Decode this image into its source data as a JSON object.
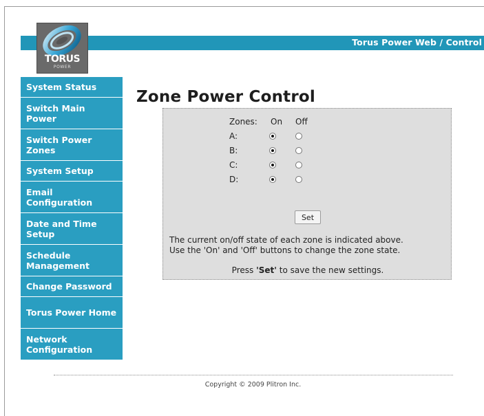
{
  "header": {
    "title": "Torus Power Web / Control",
    "logo_text": "TORUS",
    "logo_subtext": "POWER"
  },
  "sidebar": {
    "items": [
      {
        "label": "System Status"
      },
      {
        "label": "Switch Main Power"
      },
      {
        "label": "Switch Power Zones"
      },
      {
        "label": "System Setup"
      },
      {
        "label": "Email Configuration"
      },
      {
        "label": "Date and Time Setup"
      },
      {
        "label": "Schedule Management"
      },
      {
        "label": "Change Password"
      },
      {
        "label": "Torus Power Home"
      },
      {
        "label": "Network Configuration"
      }
    ]
  },
  "main": {
    "title": "Zone Power Control",
    "zones_header": "Zones:",
    "on_header": "On",
    "off_header": "Off",
    "zones": [
      {
        "label": "A:",
        "state": "on"
      },
      {
        "label": "B:",
        "state": "on"
      },
      {
        "label": "C:",
        "state": "on"
      },
      {
        "label": "D:",
        "state": "on"
      }
    ],
    "set_label": "Set",
    "info_line1": "The current on/off state of each zone is indicated above.",
    "info_line2": "Use the 'On' and 'Off' buttons to change the zone state.",
    "press_prefix": "Press ",
    "press_bold": "'Set'",
    "press_suffix": " to save the new settings."
  },
  "footer": {
    "copyright": "Copyright © 2009 Plitron Inc."
  },
  "colors": {
    "accent": "#2a9ec1",
    "header_bar": "#2196b8",
    "panel_bg": "#dedede"
  },
  "icons": {
    "logo": "torus-ring-logo"
  }
}
